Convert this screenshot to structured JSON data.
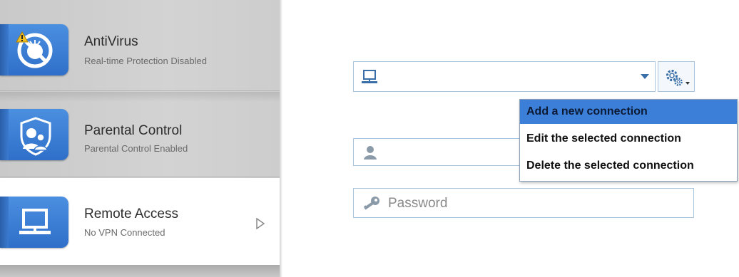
{
  "sidebar": {
    "items": [
      {
        "title": "AntiVirus",
        "subtitle": "Real-time Protection Disabled",
        "icon": "antivirus-icon",
        "badge": "warning-icon"
      },
      {
        "title": "Parental Control",
        "subtitle": "Parental Control Enabled",
        "icon": "parental-control-icon"
      },
      {
        "title": "Remote Access",
        "subtitle": "No VPN Connected",
        "icon": "laptop-icon",
        "selected": true
      }
    ]
  },
  "form": {
    "connection": {
      "value": "",
      "icon": "computer-icon"
    },
    "username": {
      "value": "",
      "icon": "user-icon"
    },
    "password": {
      "placeholder": "Password",
      "icon": "key-icon"
    }
  },
  "menu": {
    "items": [
      "Add a new connection",
      "Edit the selected connection",
      "Delete the selected connection"
    ],
    "highlighted_index": 0
  },
  "colors": {
    "accent": "#3b7fd9",
    "tile": "#3a7ad0",
    "field_border": "#a9c4dc",
    "warning": "#f0c020"
  }
}
